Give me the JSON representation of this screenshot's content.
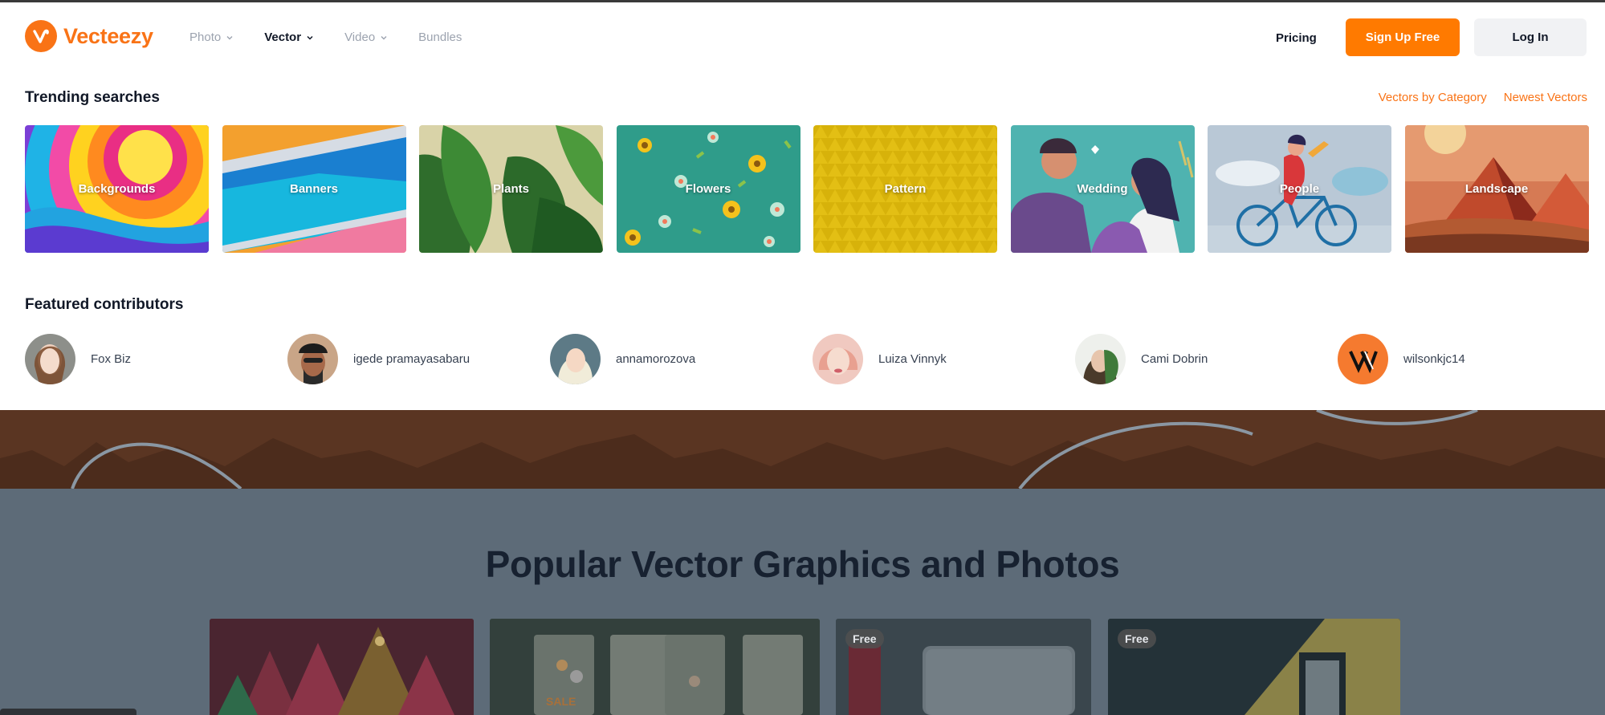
{
  "brand": {
    "name": "Vecteezy",
    "logo_icon": "vecteezy-v-icon",
    "accent": "#f97316"
  },
  "nav": {
    "items": [
      {
        "label": "Photo",
        "has_dropdown": true,
        "active": false
      },
      {
        "label": "Vector",
        "has_dropdown": true,
        "active": true
      },
      {
        "label": "Video",
        "has_dropdown": true,
        "active": false
      },
      {
        "label": "Bundles",
        "has_dropdown": false,
        "active": false
      }
    ],
    "pricing": "Pricing",
    "signup": "Sign Up Free",
    "login": "Log In"
  },
  "trending": {
    "title": "Trending searches",
    "links": [
      "Vectors by Category",
      "Newest Vectors"
    ],
    "tiles": [
      {
        "label": "Backgrounds"
      },
      {
        "label": "Banners"
      },
      {
        "label": "Plants"
      },
      {
        "label": "Flowers"
      },
      {
        "label": "Pattern"
      },
      {
        "label": "Wedding"
      },
      {
        "label": "People"
      },
      {
        "label": "Landscape"
      }
    ]
  },
  "contributors": {
    "title": "Featured contributors",
    "items": [
      {
        "name": "Fox Biz"
      },
      {
        "name": "igede pramayasabaru"
      },
      {
        "name": "annamorozova"
      },
      {
        "name": "Luiza Vinnyk"
      },
      {
        "name": "Cami Dobrin"
      },
      {
        "name": "wilsonkjc14"
      }
    ]
  },
  "popular": {
    "title": "Popular Vector Graphics and Photos",
    "cards": [
      {
        "badge": ""
      },
      {
        "badge": "",
        "text": "SALE"
      },
      {
        "badge": "Free"
      },
      {
        "badge": "Free"
      }
    ]
  }
}
